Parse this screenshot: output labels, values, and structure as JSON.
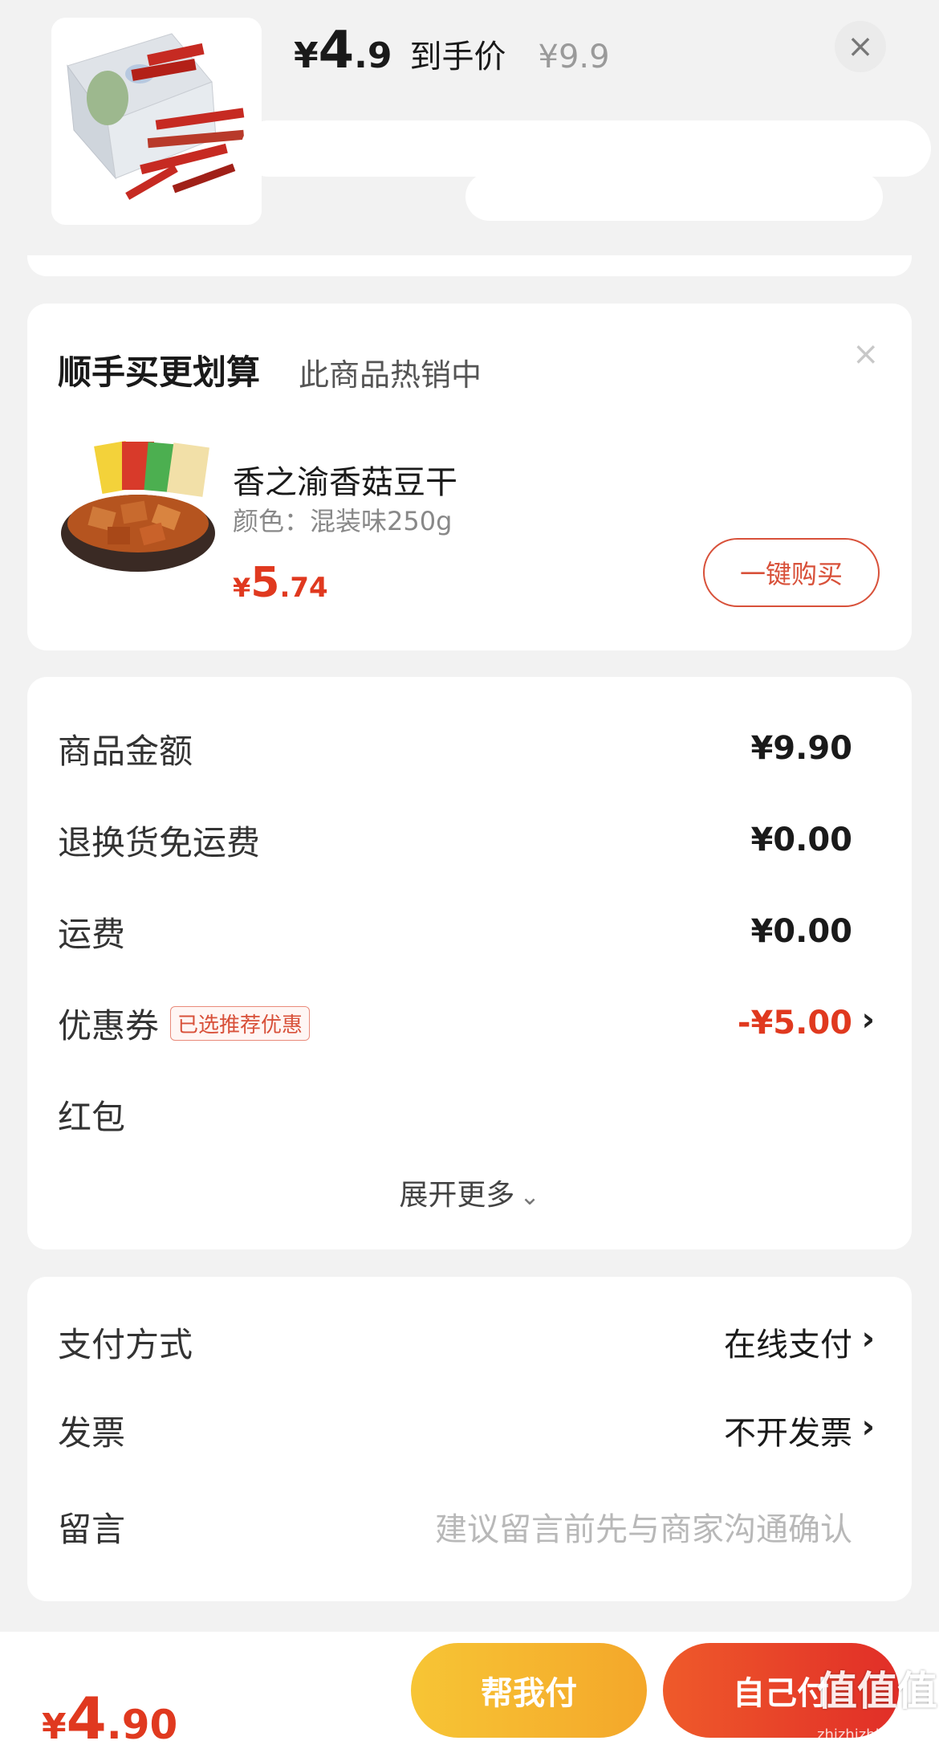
{
  "header": {
    "price_currency": "¥",
    "price_int": "4",
    "price_dec": ".9",
    "price_tag": "到手价",
    "original_price": "¥9.9",
    "close_icon": "close-icon"
  },
  "recommend": {
    "title": "顺手买更划算",
    "subtitle": "此商品热销中",
    "product_name": "香之渝香菇豆干",
    "product_spec": "颜色：混装味250g",
    "price_currency": "¥",
    "price_int": "5",
    "price_dec": ".74",
    "buy_label": "一键购买"
  },
  "summary": {
    "rows": [
      {
        "label": "商品金额",
        "value": "¥9.90"
      },
      {
        "label": "退换货免运费",
        "value": "¥0.00"
      },
      {
        "label": "运费",
        "value": "¥0.00"
      },
      {
        "label": "优惠券",
        "badge": "已选推荐优惠",
        "value": "-¥5.00"
      },
      {
        "label": "红包",
        "value": ""
      }
    ],
    "expand_label": "展开更多",
    "accent_color": "#e0391f"
  },
  "payment": {
    "method_label": "支付方式",
    "method_value": "在线支付",
    "invoice_label": "发票",
    "invoice_value": "不开发票",
    "note_label": "留言",
    "note_placeholder": "建议留言前先与商家沟通确认"
  },
  "footer": {
    "total_currency": "¥",
    "total_int": "4",
    "total_dec": ".90",
    "help_pay_label": "帮我付",
    "self_pay_label": "自己付"
  },
  "watermark": {
    "text": "值值值",
    "sub": "zhizhizhi.com"
  }
}
